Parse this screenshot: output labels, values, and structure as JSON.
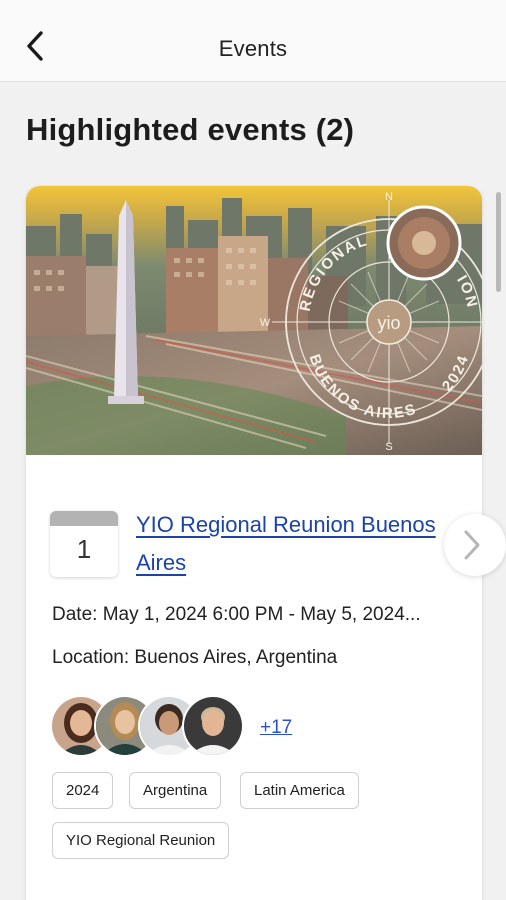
{
  "header": {
    "title": "Events",
    "back_icon": "chevron-left-icon"
  },
  "section": {
    "title": "Highlighted events (2)"
  },
  "event": {
    "day": "1",
    "title": "YIO Regional Reunion Buenos Aires",
    "date_label": "Date:",
    "date_value": "May 1, 2024 6:00 PM - May 5, 2024...",
    "location_label": "Location:",
    "location_value": "Buenos Aires, Argentina",
    "attendees_more": "+17",
    "tags": [
      "2024",
      "Argentina",
      "Latin America",
      "YIO Regional Reunion"
    ],
    "banner": {
      "ring_top": "REGIONAL",
      "ring_top_end": "ION",
      "ring_bottom": "BUENOS AIRES",
      "year": "2024",
      "logo": "yio",
      "compass_n": "N",
      "compass_s": "S",
      "compass_w": "W"
    }
  },
  "next_icon": "chevron-right-icon",
  "colors": {
    "link": "#1b43a8",
    "background": "#f1f1f1",
    "card": "#ffffff"
  }
}
